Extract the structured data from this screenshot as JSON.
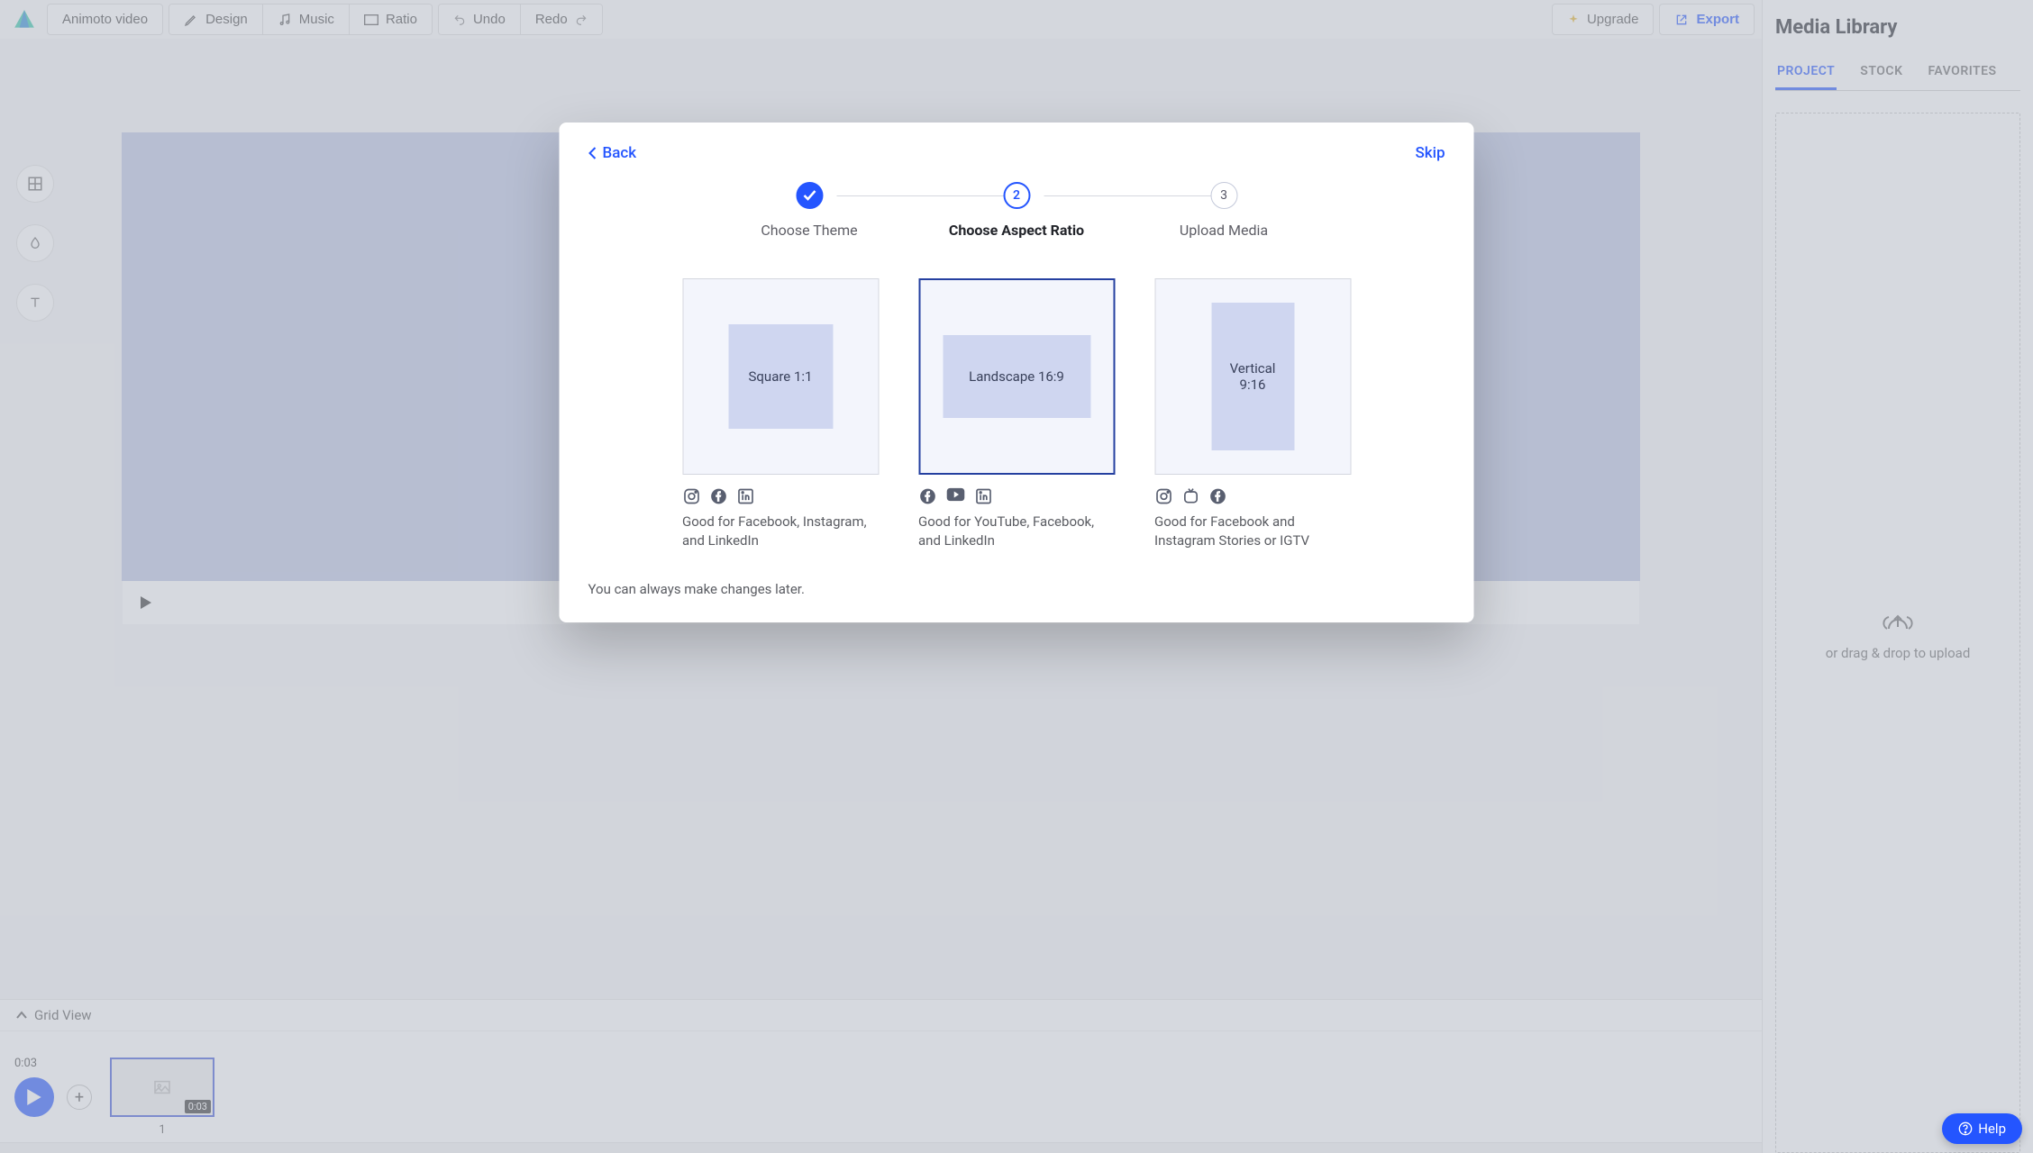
{
  "toolbar": {
    "title": "Animoto video",
    "design": "Design",
    "music": "Music",
    "ratio": "Ratio",
    "undo": "Undo",
    "redo": "Redo",
    "upgrade": "Upgrade",
    "export": "Export"
  },
  "canvas": {
    "grid_view": "Grid View"
  },
  "timeline": {
    "current_time": "0:03",
    "add": "+",
    "clips": [
      {
        "duration": "0:03",
        "index": "1"
      }
    ]
  },
  "sidebar": {
    "title": "Media Library",
    "tabs": [
      "PROJECT",
      "STOCK",
      "FAVORITES"
    ],
    "active_tab": 0,
    "drop_text": "or drag & drop to upload"
  },
  "modal": {
    "back": "Back",
    "skip": "Skip",
    "steps": [
      {
        "label": "Choose Theme",
        "state": "completed"
      },
      {
        "label": "Choose Aspect Ratio",
        "state": "current"
      },
      {
        "label": "Upload Media",
        "state": "pending",
        "num": "3"
      }
    ],
    "ratios": [
      {
        "id": "square",
        "label": "Square 1:1",
        "desc": "Good for Facebook, Instagram, and LinkedIn",
        "social": [
          "instagram",
          "facebook",
          "linkedin"
        ]
      },
      {
        "id": "landscape",
        "label": "Landscape 16:9",
        "desc": "Good for YouTube, Facebook, and LinkedIn",
        "social": [
          "facebook",
          "youtube",
          "linkedin"
        ],
        "selected": true
      },
      {
        "id": "vertical",
        "label": "Vertical 9:16",
        "desc": "Good for Facebook and Instagram Stories or IGTV",
        "social": [
          "instagram",
          "igtv",
          "facebook"
        ]
      }
    ],
    "note": "You can always make changes later."
  },
  "help": {
    "label": "Help"
  }
}
